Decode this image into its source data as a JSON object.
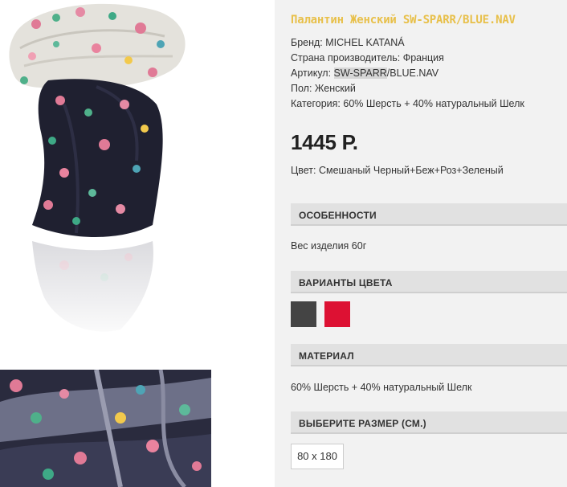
{
  "product": {
    "title": "Палантин Женский SW-SPARR/BLUE.NAV",
    "brand_label": "Бренд: ",
    "brand_value": "MICHEL KATANÁ",
    "country_label": "Страна производитель: ",
    "country_value": "Франция",
    "sku_label": "Артикул: ",
    "sku_value_highlight": "SW-SPARR",
    "sku_value_rest": "/BLUE.NAV",
    "gender_label": "Пол: ",
    "gender_value": "Женский",
    "category_label": "Категория: ",
    "category_value": "60% Шерсть + 40% натуральный Шелк",
    "price": "1445 Р.",
    "color_label": "Цвет: ",
    "color_value": "Смешаный Черный+Беж+Роз+Зеленый"
  },
  "sections": {
    "features_title": "ОСОБЕННОСТИ",
    "features_text": "Вес изделия 60г",
    "color_variants_title": "ВАРИАНТЫ ЦВЕТА",
    "material_title": "МАТЕРИАЛ",
    "material_text": "60% Шерсть + 40% натуральный Шелк",
    "size_title": "ВЫБЕРИТЕ РАЗМЕР (СМ.)",
    "size_option": "80 x 180"
  },
  "swatches": [
    {
      "name": "dark-grey",
      "color": "#444444"
    },
    {
      "name": "red",
      "color": "#dd1133"
    }
  ],
  "colors": {
    "title": "#e8c04a",
    "panel_bg": "#f2f2f2",
    "section_bg": "#e1e1e1"
  }
}
